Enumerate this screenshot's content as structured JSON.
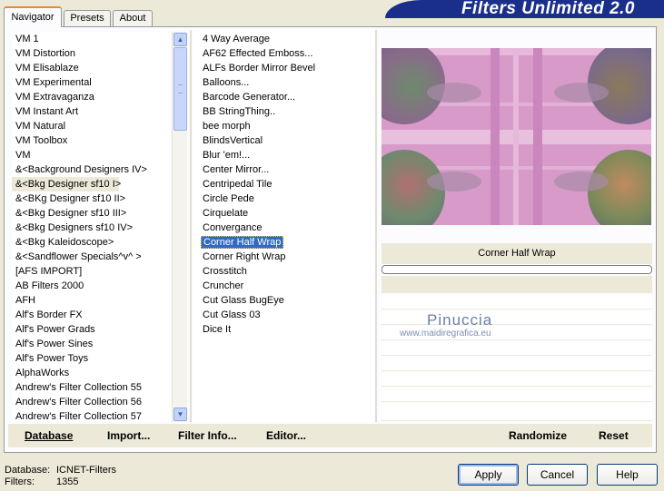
{
  "app_title": "Filters Unlimited 2.0",
  "tabs": [
    {
      "label": "Navigator",
      "active": true
    },
    {
      "label": "Presets",
      "active": false
    },
    {
      "label": "About",
      "active": false
    }
  ],
  "categories": {
    "selected": "&<Bkg Designer sf10 I>",
    "items": [
      "VM 1",
      "VM Distortion",
      "VM Elisablaze",
      "VM Experimental",
      "VM Extravaganza",
      "VM Instant Art",
      "VM Natural",
      "VM Toolbox",
      "VM",
      "&<Background Designers IV>",
      "&<Bkg Designer sf10 I>",
      "&<BKg Designer sf10 II>",
      "&<Bkg Designer sf10 III>",
      "&<Bkg Designers sf10 IV>",
      "&<Bkg Kaleidoscope>",
      "&<Sandflower Specials^v^ >",
      "[AFS IMPORT]",
      "AB Filters 2000",
      "AFH",
      "Alf's Border FX",
      "Alf's Power Grads",
      "Alf's Power Sines",
      "Alf's Power Toys",
      "AlphaWorks",
      "Andrew's Filter Collection 55",
      "Andrew's Filter Collection 56",
      "Andrew's Filter Collection 57"
    ]
  },
  "filters": {
    "selected": "Corner Half Wrap",
    "items": [
      "4 Way Average",
      "AF62 Effected Emboss...",
      "ALFs Border Mirror Bevel",
      "Balloons...",
      "Barcode Generator...",
      "BB StringThing..",
      "bee morph",
      "BlindsVertical",
      "Blur 'em!...",
      "Center Mirror...",
      "Centripedal Tile",
      "Circle Pede",
      "Cirquelate",
      "Convergance",
      "Corner Half Wrap",
      "Corner Right Wrap",
      "Crosstitch",
      "Cruncher",
      "Cut Glass  BugEye",
      "Cut Glass 03",
      "Dice It"
    ]
  },
  "preview": {
    "filter_name": "Corner Half Wrap",
    "watermark_name": "Pinuccia",
    "watermark_url": "www.maidiregrafica.eu"
  },
  "actions": {
    "database": "Database",
    "import": "Import...",
    "filter_info": "Filter Info...",
    "editor": "Editor...",
    "randomize": "Randomize",
    "reset": "Reset"
  },
  "footer": {
    "database_label": "Database:",
    "database_value": "ICNET-Filters",
    "filters_label": "Filters:",
    "filters_value": "1355"
  },
  "buttons": {
    "apply": "Apply",
    "cancel": "Cancel",
    "help": "Help"
  },
  "colors": {
    "banner": "#1a2f8a",
    "selection": "#316ac5",
    "preview_base": "#d79ac9"
  }
}
